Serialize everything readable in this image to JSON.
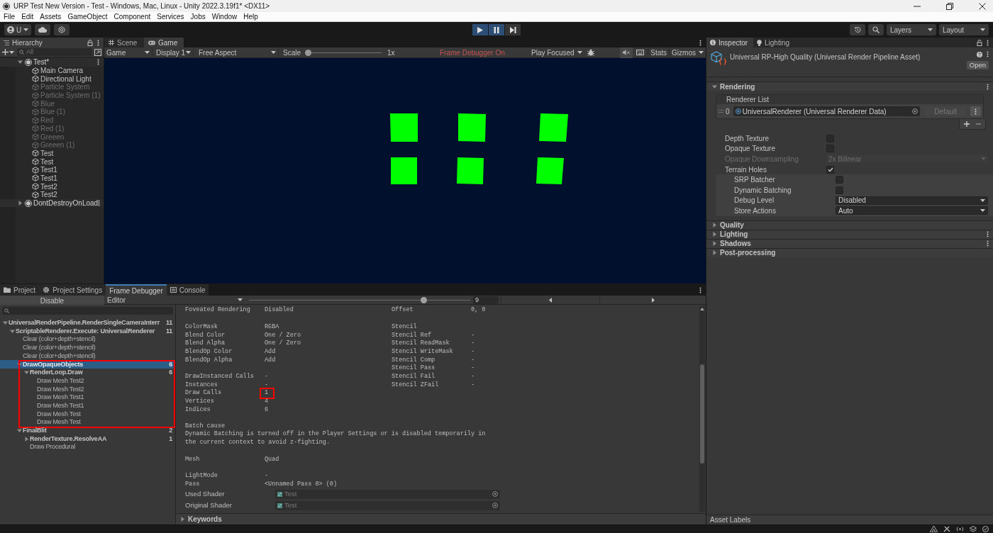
{
  "window": {
    "title": "URP Test New Version - Test - Windows, Mac, Linux - Unity 2022.3.19f1* <DX11>"
  },
  "menu": [
    "File",
    "Edit",
    "Assets",
    "GameObject",
    "Component",
    "Services",
    "Jobs",
    "Window",
    "Help"
  ],
  "toolbar": {
    "account": "U",
    "playback": [
      {
        "kind": "play",
        "selected": true
      },
      {
        "kind": "pause",
        "selected": true
      },
      {
        "kind": "step",
        "selected": false
      }
    ],
    "layers": "Layers",
    "layout": "Layout"
  },
  "hierarchy": {
    "tab": "Hierarchy",
    "search": {
      "placeholder": "All"
    },
    "scenes": [
      {
        "name": "Test*",
        "expanded": true,
        "objects": [
          {
            "name": "Main Camera",
            "active": true
          },
          {
            "name": "Directional Light",
            "active": true
          },
          {
            "name": "Particle System",
            "active": false
          },
          {
            "name": "Particle System (1)",
            "active": false
          },
          {
            "name": "Blue",
            "active": false
          },
          {
            "name": "Blue (1)",
            "active": false
          },
          {
            "name": "Red",
            "active": false
          },
          {
            "name": "Red (1)",
            "active": false
          },
          {
            "name": "Greeen",
            "active": false
          },
          {
            "name": "Greeen (1)",
            "active": false
          },
          {
            "name": "Test",
            "active": true
          },
          {
            "name": "Test",
            "active": true
          },
          {
            "name": "Test1",
            "active": true
          },
          {
            "name": "Test1",
            "active": true
          },
          {
            "name": "Test2",
            "active": true
          },
          {
            "name": "Test2",
            "active": true
          }
        ]
      },
      {
        "name": "DontDestroyOnLoad",
        "expanded": false
      }
    ]
  },
  "game_view": {
    "tabs": [
      {
        "label": "Scene",
        "kind": "scene",
        "selected": false
      },
      {
        "label": "Game",
        "kind": "game",
        "selected": true
      }
    ],
    "mode": "Game",
    "display": "Display 1",
    "aspect": "Free Aspect",
    "scale_label": "Scale",
    "scale": {
      "level": 0
    },
    "scale_value": "1x",
    "notice": "Frame Debugger On",
    "play_mode": "Play Focused",
    "stats": "Stats",
    "gizmos": "Gizmos"
  },
  "bottom_panel": {
    "tabs": [
      {
        "label": "Project",
        "kind": "folder",
        "selected": false
      },
      {
        "label": "Project Settings",
        "kind": "gear",
        "selected": false
      },
      {
        "label": "Frame Debugger",
        "kind": "none",
        "selected": true
      },
      {
        "label": "Console",
        "kind": "console",
        "selected": false
      }
    ],
    "frame_debugger": {
      "toggle": "Disable",
      "target": "Editor",
      "slider": {
        "level": 0.8
      },
      "event_index": "9",
      "events": [
        {
          "name": "UniversalRenderPipeline.RenderSingleCameraInterr",
          "count": "11",
          "expanded": true,
          "selected": false,
          "highlighted": false,
          "children": [
            {
              "name": "ScriptableRenderer.Execute: UniversalRenderer",
              "count": "11",
              "expanded": true,
              "selected": false,
              "highlighted": false,
              "children": [
                {
                  "name": "Clear (color+depth+stencil)",
                  "selected": false,
                  "highlighted": false
                },
                {
                  "name": "Clear (color+depth+stencil)",
                  "selected": false,
                  "highlighted": false
                },
                {
                  "name": "Clear (color+depth+stencil)",
                  "selected": false,
                  "highlighted": false
                },
                {
                  "name": "DrawOpaqueObjects",
                  "count": "6",
                  "expanded": true,
                  "selected": true,
                  "highlighted": true,
                  "children": [
                    {
                      "name": "RenderLoop.Draw",
                      "count": "6",
                      "expanded": true,
                      "selected": false,
                      "highlighted": false,
                      "children": [
                        {
                          "name": "Draw Mesh Test2",
                          "selected": false,
                          "highlighted": false
                        },
                        {
                          "name": "Draw Mesh Test2",
                          "selected": false,
                          "highlighted": false
                        },
                        {
                          "name": "Draw Mesh Test1",
                          "selected": false,
                          "highlighted": false
                        },
                        {
                          "name": "Draw Mesh Test1",
                          "selected": false,
                          "highlighted": false
                        },
                        {
                          "name": "Draw Mesh Test",
                          "selected": false,
                          "highlighted": false
                        },
                        {
                          "name": "Draw Mesh Test",
                          "selected": false,
                          "highlighted": false
                        }
                      ]
                    }
                  ]
                },
                {
                  "name": "FinalBlit",
                  "count": "2",
                  "expanded": true,
                  "selected": false,
                  "highlighted": false,
                  "children": [
                    {
                      "name": "RenderTexture.ResolveAA",
                      "count": "1",
                      "expanded": false,
                      "selected": false,
                      "highlighted": false
                    },
                    {
                      "name": "Draw Procedural",
                      "selected": false,
                      "highlighted": false
                    }
                  ]
                }
              ]
            }
          ]
        }
      ],
      "details": {
        "left": [
          [
            {
              "label": "Foveated Rendering",
              "value": "Disabled",
              "highlighted": false
            }
          ],
          [
            {
              "label": "ColorMask",
              "value": "RGBA",
              "highlighted": false
            },
            {
              "label": "Blend Color",
              "value": "One / Zero",
              "highlighted": false
            },
            {
              "label": "Blend Alpha",
              "value": "One / Zero",
              "highlighted": false
            },
            {
              "label": "BlendOp Color",
              "value": "Add",
              "highlighted": false
            },
            {
              "label": "BlendOp Alpha",
              "value": "Add",
              "highlighted": false
            }
          ],
          [
            {
              "label": "DrawInstanced Calls",
              "value": "-",
              "highlighted": false
            },
            {
              "label": "Instances",
              "value": "-",
              "highlighted": false
            },
            {
              "label": "Draw Calls",
              "value": "1",
              "highlighted": true
            },
            {
              "label": "Vertices",
              "value": "4",
              "highlighted": false
            },
            {
              "label": "Indices",
              "value": "6",
              "highlighted": false
            }
          ]
        ],
        "right": [
          [
            {
              "label": "Offset",
              "value": "0, 0"
            }
          ],
          [
            {
              "label": "Stencil"
            },
            {
              "label": "Stencil Ref",
              "value": "-"
            },
            {
              "label": "Stencil ReadMask",
              "value": "-"
            },
            {
              "label": "Stencil WriteMask",
              "value": "-"
            },
            {
              "label": "Stencil Comp",
              "value": "-"
            },
            {
              "label": "Stencil Pass",
              "value": "-"
            },
            {
              "label": "Stencil Fail",
              "value": "-"
            },
            {
              "label": "Stencil ZFail",
              "value": "-"
            }
          ]
        ],
        "batch_cause": {
          "title": "Batch cause",
          "text": "Dynamic Batching is turned off in the Player Settings or is disabled temporarily in the current context to avoid z-fighting."
        },
        "mesh": {
          "label": "Mesh",
          "value": "Quad"
        },
        "pass_rows": [
          {
            "label": "LightMode",
            "value": "-"
          },
          {
            "label": "Pass",
            "value": "<Unnamed Pass 0> (0)"
          }
        ],
        "shaders": [
          {
            "label": "Used Shader",
            "value": "Test"
          },
          {
            "label": "Original Shader",
            "value": "Test"
          }
        ],
        "keywords": {
          "title": "Keywords",
          "expanded": false
        }
      }
    }
  },
  "inspector": {
    "tabs": [
      {
        "label": "Inspector",
        "kind": "info",
        "selected": true
      },
      {
        "label": "Lighting",
        "kind": "bulb",
        "selected": false
      }
    ],
    "asset_title": "Universal RP-High Quality (Universal Render Pipeline Asset)",
    "open_button": "Open",
    "sections": [
      {
        "title": "Rendering",
        "expanded": true,
        "menu": true
      },
      {
        "title": "Quality",
        "expanded": false,
        "menu": false
      },
      {
        "title": "Lighting",
        "expanded": false,
        "menu": true
      },
      {
        "title": "Shadows",
        "expanded": false,
        "menu": true
      },
      {
        "title": "Post-processing",
        "expanded": false,
        "menu": false
      }
    ],
    "renderer_list": {
      "title": "Renderer List",
      "items": [
        {
          "index": "0",
          "name": "UniversalRenderer (Universal Renderer Data)",
          "button": "Default"
        }
      ]
    },
    "properties": [
      {
        "label": "Depth Texture",
        "kind": "checkbox",
        "checked": false,
        "disabled": false,
        "shaded": false
      },
      {
        "label": "Opaque Texture",
        "kind": "checkbox",
        "checked": false,
        "disabled": false,
        "shaded": false
      },
      {
        "label": "Opaque Downsampling",
        "kind": "dropdown",
        "value": "2x Bilinear",
        "disabled": true,
        "shaded": false
      },
      {
        "label": "Terrain Holes",
        "kind": "checkbox",
        "checked": true,
        "disabled": false,
        "shaded": false
      },
      {
        "label": "SRP Batcher",
        "kind": "checkbox",
        "checked": false,
        "disabled": false,
        "shaded": true
      },
      {
        "label": "Dynamic Batching",
        "kind": "checkbox",
        "checked": false,
        "disabled": false,
        "shaded": true
      },
      {
        "label": "Debug Level",
        "kind": "dropdown",
        "value": "Disabled",
        "disabled": false,
        "shaded": true
      },
      {
        "label": "Store Actions",
        "kind": "dropdown",
        "value": "Auto",
        "disabled": false,
        "shaded": true
      }
    ],
    "footer": "Asset Labels"
  }
}
